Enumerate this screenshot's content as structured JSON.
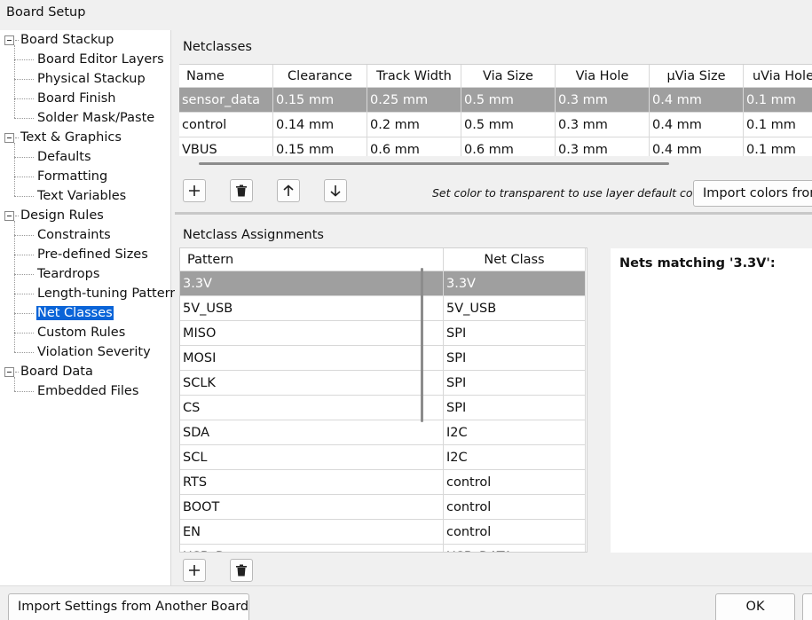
{
  "window": {
    "title": "Board Setup"
  },
  "tree": {
    "items": [
      {
        "label": "Board Stackup",
        "level": 0,
        "expandable": true
      },
      {
        "label": "Board Editor Layers",
        "level": 1
      },
      {
        "label": "Physical Stackup",
        "level": 1
      },
      {
        "label": "Board Finish",
        "level": 1
      },
      {
        "label": "Solder Mask/Paste",
        "level": 1
      },
      {
        "label": "Text & Graphics",
        "level": 0,
        "expandable": true
      },
      {
        "label": "Defaults",
        "level": 1
      },
      {
        "label": "Formatting",
        "level": 1
      },
      {
        "label": "Text Variables",
        "level": 1
      },
      {
        "label": "Design Rules",
        "level": 0,
        "expandable": true
      },
      {
        "label": "Constraints",
        "level": 1
      },
      {
        "label": "Pre-defined Sizes",
        "level": 1
      },
      {
        "label": "Teardrops",
        "level": 1
      },
      {
        "label": "Length-tuning Patterns",
        "level": 1
      },
      {
        "label": "Net Classes",
        "level": 1,
        "selected": true
      },
      {
        "label": "Custom Rules",
        "level": 1
      },
      {
        "label": "Violation Severity",
        "level": 1
      },
      {
        "label": "Board Data",
        "level": 0,
        "expandable": true
      },
      {
        "label": "Embedded Files",
        "level": 1
      }
    ]
  },
  "netclasses": {
    "title": "Netclasses",
    "headers": [
      "Name",
      "Clearance",
      "Track Width",
      "Via Size",
      "Via Hole",
      "µVia Size",
      "uVia Hole"
    ],
    "rows": [
      [
        "sensor_data",
        "0.15 mm",
        "0.25 mm",
        "0.5 mm",
        "0.3 mm",
        "0.4 mm",
        "0.1 mm"
      ],
      [
        "control",
        "0.14 mm",
        "0.2 mm",
        "0.5 mm",
        "0.3 mm",
        "0.4 mm",
        "0.1 mm"
      ],
      [
        "VBUS",
        "0.15 mm",
        "0.6 mm",
        "0.6 mm",
        "0.3 mm",
        "0.4 mm",
        "0.1 mm"
      ]
    ],
    "hint": "Set color to transparent to use layer default color.",
    "import_colors_label": "Import colors from"
  },
  "assignments": {
    "title": "Netclass Assignments",
    "headers": [
      "Pattern",
      "Net Class"
    ],
    "rows": [
      [
        "3.3V",
        "3.3V"
      ],
      [
        "5V_USB",
        "5V_USB"
      ],
      [
        "MISO",
        "SPI"
      ],
      [
        "MOSI",
        "SPI"
      ],
      [
        "SCLK",
        "SPI"
      ],
      [
        "CS",
        "SPI"
      ],
      [
        "SDA",
        "I2C"
      ],
      [
        "SCL",
        "I2C"
      ],
      [
        "RTS",
        "control"
      ],
      [
        "BOOT",
        "control"
      ],
      [
        "EN",
        "control"
      ],
      [
        "USB_D",
        "USB_DATA"
      ]
    ],
    "nets_matching_label": "Nets matching '3.3V':"
  },
  "footer": {
    "import_settings_label": "Import Settings from Another Board...",
    "ok_label": "OK"
  },
  "icons": [
    "plus-icon",
    "trash-icon",
    "arrow-up-icon",
    "arrow-down-icon"
  ]
}
